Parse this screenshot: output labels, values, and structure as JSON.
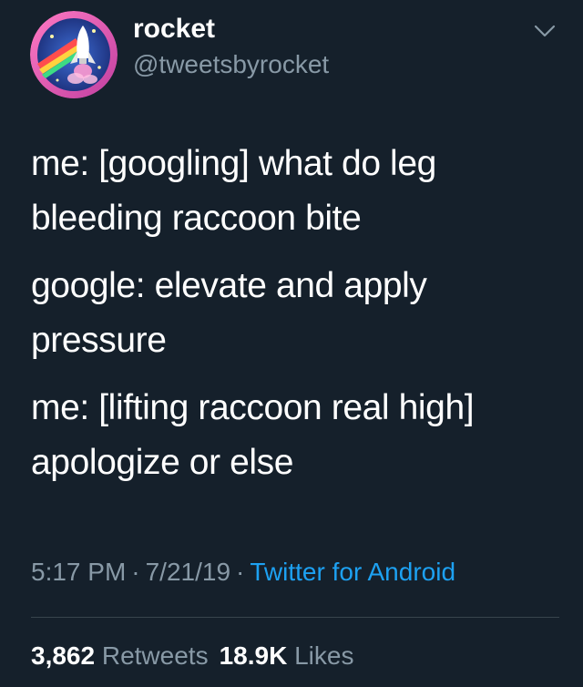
{
  "author": {
    "name": "rocket",
    "handle": "@tweetsbyrocket",
    "avatar_icon": "rocket-avatar-icon"
  },
  "tweet": {
    "paragraphs": [
      "me: [googling] what do leg bleeding raccoon bite",
      "google: elevate and apply pressure",
      "me: [lifting raccoon real high] apologize or else"
    ],
    "time": "5:17 PM",
    "date": "7/21/19",
    "separator": "·",
    "source": "Twitter for Android"
  },
  "stats": {
    "retweets_count": "3,862",
    "retweets_label": "Retweets",
    "likes_count": "18.9K",
    "likes_label": "Likes"
  },
  "colors": {
    "background": "#15202b",
    "text": "#ffffff",
    "secondary": "#8899a6",
    "link": "#1da1f2",
    "divider": "#38444d"
  }
}
